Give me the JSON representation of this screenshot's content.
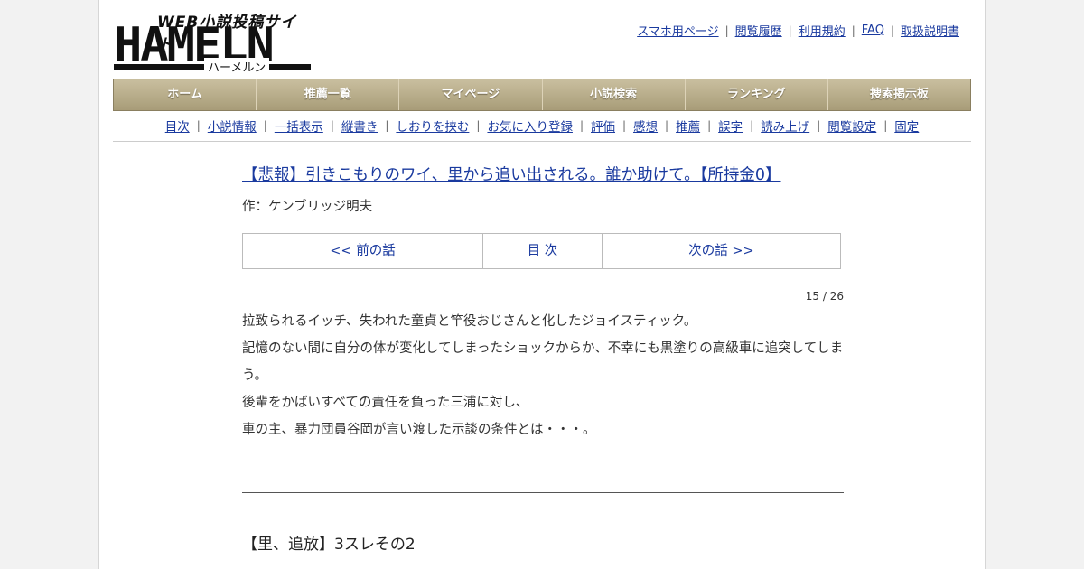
{
  "logo": {
    "tagline": "WEB小説投稿サイト",
    "name": "HAMELN",
    "kana": "ハーメルン"
  },
  "top_links": [
    "スマホ用ページ",
    "閲覧履歴",
    "利用規約",
    "FAQ",
    "取扱説明書"
  ],
  "global_nav": [
    "ホーム",
    "推薦一覧",
    "マイページ",
    "小説検索",
    "ランキング",
    "捜索掲示板"
  ],
  "sub_nav": [
    "目次",
    "小説情報",
    "一括表示",
    "縦書き",
    "しおりを挟む",
    "お気に入り登録",
    "評価",
    "感想",
    "推薦",
    "誤字",
    "読み上げ",
    "閲覧設定",
    "固定"
  ],
  "novel": {
    "title": "【悲報】引きこもりのワイ、里から追い出される。誰か助けて。【所持金0】",
    "author": "作：ケンブリッジ明夫"
  },
  "pager": {
    "prev": "<< 前の話",
    "toc": "目 次",
    "next": "次の話 >>"
  },
  "page_count": "15 / 26",
  "synopsis": [
    "拉致られるイッチ、失われた童貞と竿役おじさんと化したジョイスティック。",
    "記憶のない間に自分の体が変化してしまったショックからか、不幸にも黒塗りの高級車に追突してしまう。",
    "後輩をかばいすべての責任を負った三浦に対し、",
    "車の主、暴力団員谷岡が言い渡した示談の条件とは・・・。"
  ],
  "chapter_title": "【里、追放】3スレその2"
}
